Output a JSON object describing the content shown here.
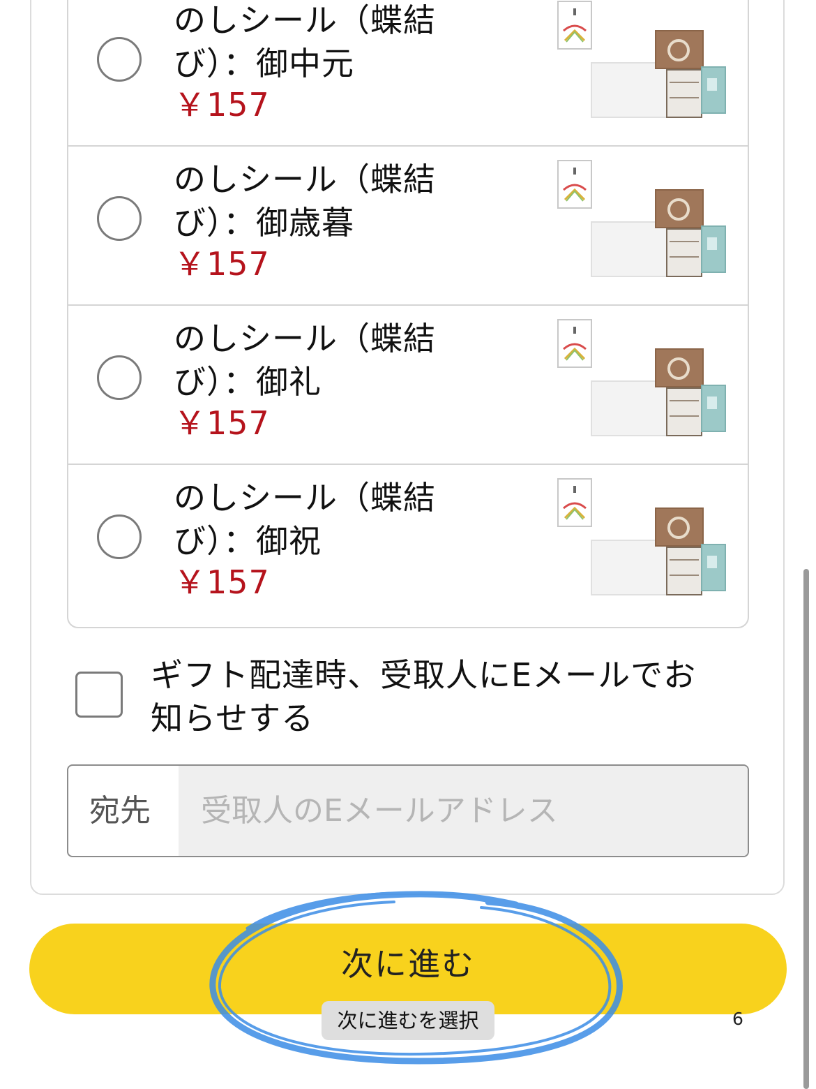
{
  "gift_options": [
    {
      "title_line1": "のしシール（蝶結",
      "title_line2": "び）：御中元",
      "price": "￥157",
      "thumb_icon": "noshi-gift-box-icon"
    },
    {
      "title_line1": "のしシール（蝶結",
      "title_line2": "び）：御歳暮",
      "price": "￥157",
      "thumb_icon": "noshi-gift-box-icon"
    },
    {
      "title_line1": "のしシール（蝶結",
      "title_line2": "び）：御礼",
      "price": "￥157",
      "thumb_icon": "noshi-gift-box-icon"
    },
    {
      "title_line1": "のしシール（蝶結",
      "title_line2": "び）：御祝",
      "price": "￥157",
      "thumb_icon": "noshi-gift-box-icon"
    }
  ],
  "notify": {
    "label_line1": "ギフト配達時、受取人にEメールでお",
    "label_line2": "知らせする",
    "checked": false
  },
  "recipient": {
    "label": "宛先",
    "placeholder": "受取人のEメールアドレス",
    "value": ""
  },
  "next_button": {
    "label": "次に進む"
  },
  "tooltip": {
    "text": "次に進むを選択"
  },
  "page_number": "6",
  "colors": {
    "price": "#b5131c",
    "button": "#f8d21d",
    "annotation": "#3b8de6"
  }
}
